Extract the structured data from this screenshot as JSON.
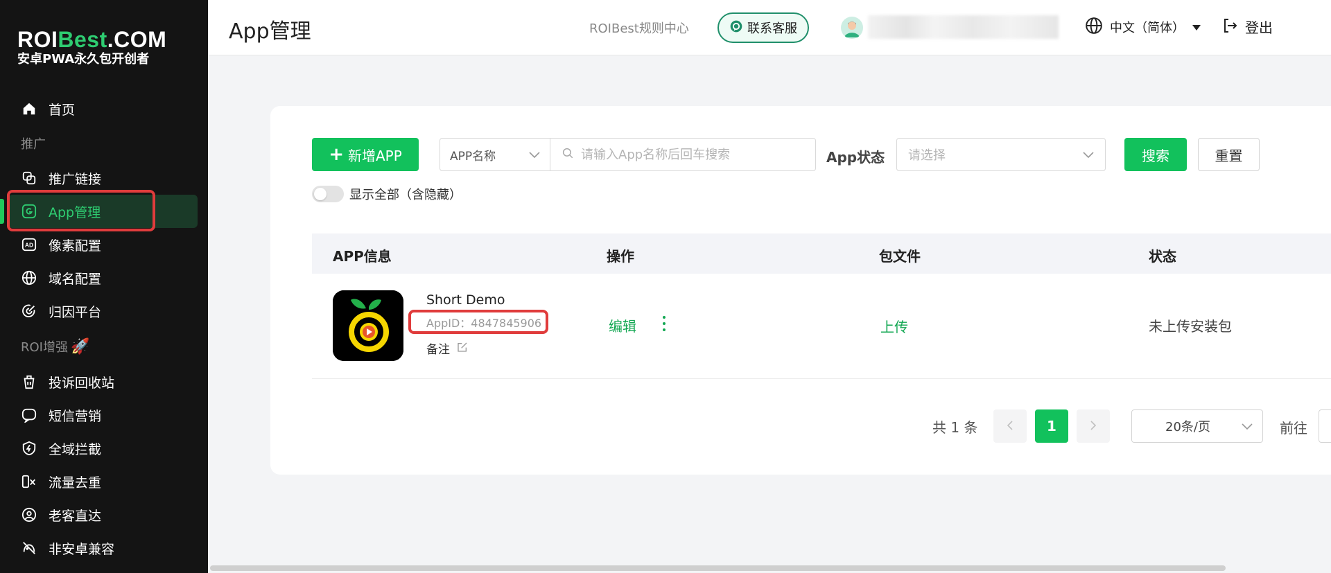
{
  "logo": {
    "brand_prefix": "ROI",
    "brand_highlight": "Best",
    "brand_suffix": ".COM",
    "tagline": "安卓PWA永久包开创者"
  },
  "sidebar": {
    "items": [
      {
        "label": "首页",
        "icon": "home-icon"
      },
      {
        "label": "推广链接",
        "icon": "link-icon"
      },
      {
        "label": "App管理",
        "icon": "app-icon",
        "active": true
      },
      {
        "label": "像素配置",
        "icon": "ad-icon"
      },
      {
        "label": "域名配置",
        "icon": "globe-icon"
      },
      {
        "label": "归因平台",
        "icon": "target-icon"
      },
      {
        "label": "投诉回收站",
        "icon": "recycle-icon"
      },
      {
        "label": "短信营销",
        "icon": "message-icon"
      },
      {
        "label": "全域拦截",
        "icon": "shield-icon"
      },
      {
        "label": "流量去重",
        "icon": "dedupe-icon"
      },
      {
        "label": "老客直达",
        "icon": "user-icon"
      },
      {
        "label": "非安卓兼容",
        "icon": "compat-icon"
      }
    ],
    "sections": {
      "promotion": "推广",
      "roi_boost": "ROI增强"
    }
  },
  "header": {
    "title": "App管理",
    "rules_link": "ROIBest规则中心",
    "service_button": "联系客服",
    "language": "中文（简体）",
    "logout": "登出"
  },
  "filters": {
    "add_button": "新增APP",
    "search_field_select": "APP名称",
    "search_placeholder": "请输入App名称后回车搜索",
    "status_label": "App状态",
    "status_placeholder": "请选择",
    "search_button": "搜索",
    "reset_button": "重置",
    "show_all_label": "显示全部（含隐藏）",
    "show_all_on": false
  },
  "table": {
    "columns": [
      "APP信息",
      "操作",
      "包文件",
      "状态"
    ],
    "rows": [
      {
        "name": "Short Demo",
        "app_id": "AppID：4847845906",
        "remark_label": "备注",
        "edit": "编辑",
        "package_action": "上传",
        "status": "未上传安装包"
      }
    ]
  },
  "pagination": {
    "total": "共 1 条",
    "prev": "‹",
    "current_page": "1",
    "next": "›",
    "page_size": "20条/页",
    "goto_label": "前往"
  },
  "colors": {
    "primary": "#12c15c",
    "sidebar_bg": "#141414",
    "highlight_red": "#e03c3c"
  }
}
